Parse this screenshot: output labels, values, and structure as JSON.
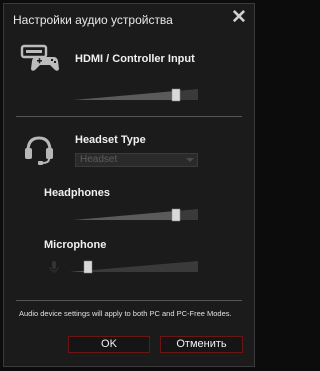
{
  "window": {
    "title": "Настройки аудио устройства",
    "close_icon": "close-icon"
  },
  "hdmi": {
    "label": "HDMI / Controller Input",
    "icon": "hdmi-controller-icon",
    "volume": 0.82
  },
  "headset": {
    "label": "Headset Type",
    "icon": "headset-icon",
    "select_value": "Headset"
  },
  "headphones": {
    "label": "Headphones",
    "volume": 0.82
  },
  "microphone": {
    "label": "Microphone",
    "icon": "microphone-icon",
    "volume": 0.14
  },
  "footer": {
    "note": "Audio device settings will apply to both PC and PC-Free Modes.",
    "ok_label": "OK",
    "cancel_label": "Отменить"
  },
  "colors": {
    "accent_border": "#6b1515",
    "background": "#1b1b1b"
  }
}
